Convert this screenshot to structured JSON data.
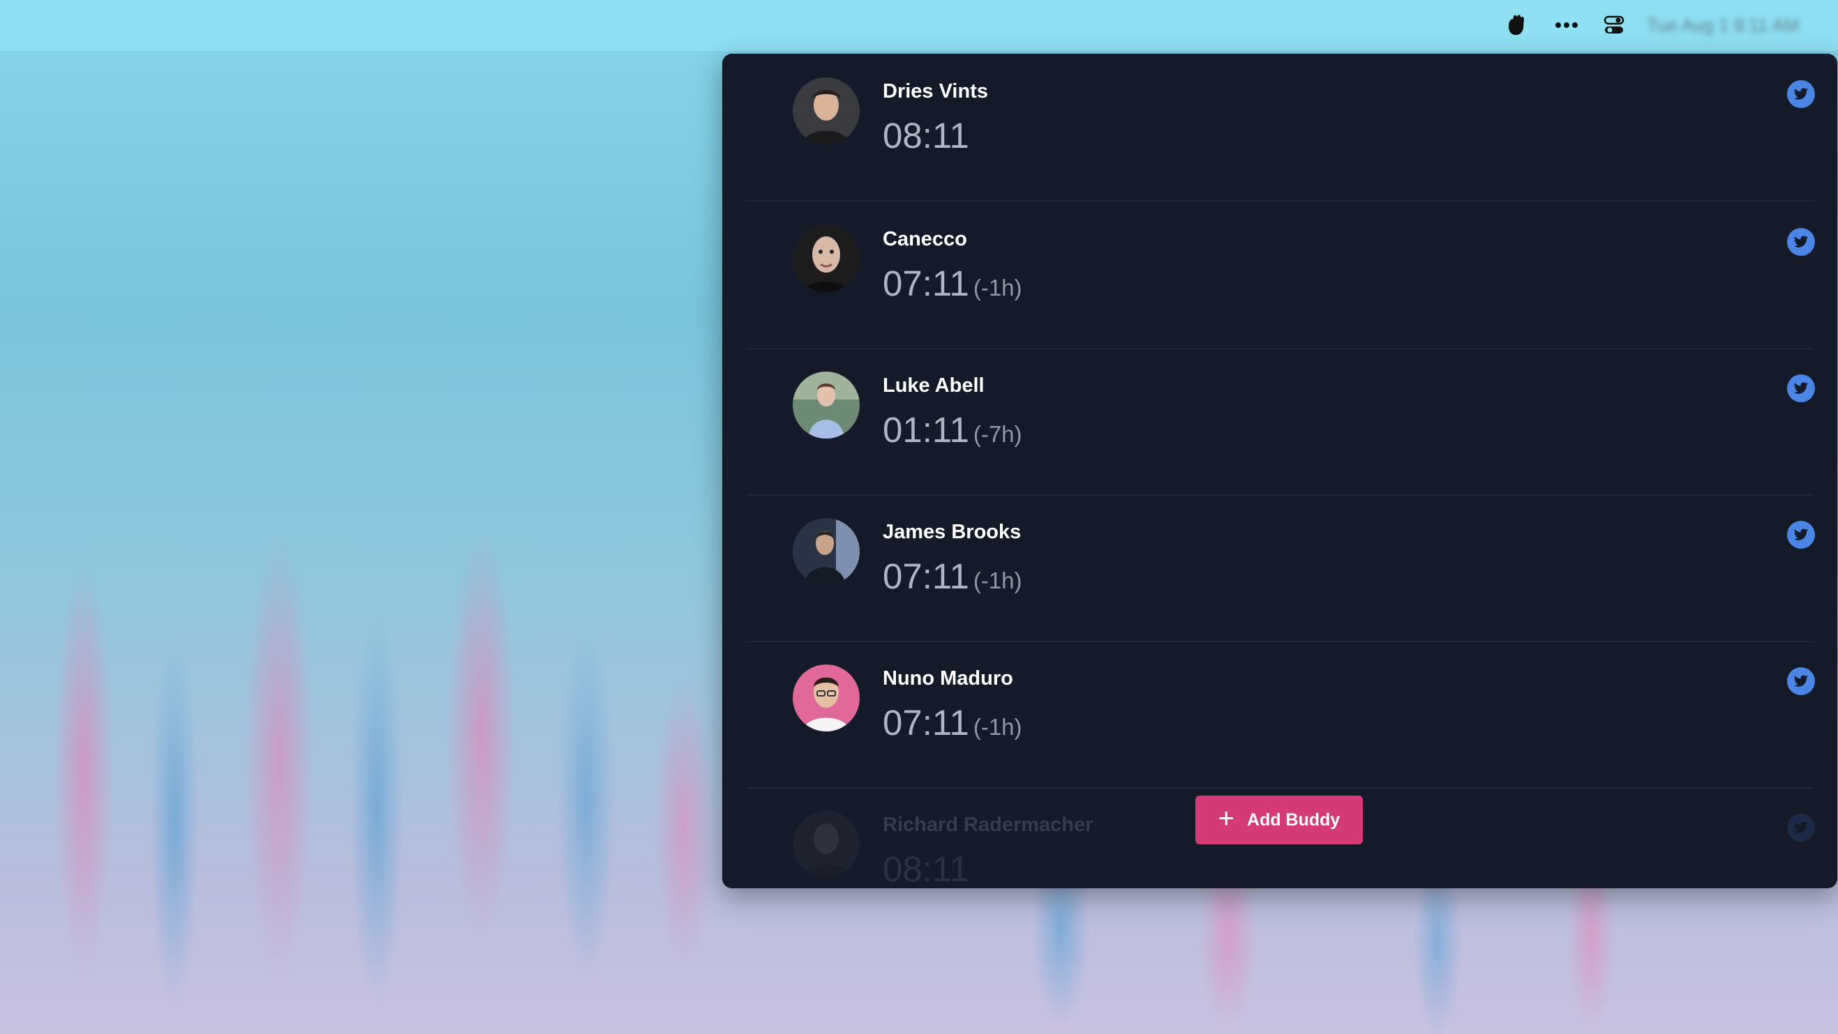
{
  "menubar": {
    "icons": [
      "hand-wave-icon",
      "more-icon",
      "control-center-icon"
    ],
    "clock": "Tue Aug 1 8:11 AM"
  },
  "buddies": [
    {
      "name": "Dries Vints",
      "time": "08:11",
      "offset": "",
      "avatar_bg": "#3a3b3f",
      "twitter_icon": "twitter-icon"
    },
    {
      "name": "Canecco",
      "time": "07:11",
      "offset": "(-1h)",
      "avatar_bg": "#1c1c1c",
      "twitter_icon": "twitter-icon"
    },
    {
      "name": "Luke Abell",
      "time": "01:11",
      "offset": "(-7h)",
      "avatar_bg": "#6f8a74",
      "twitter_icon": "twitter-icon"
    },
    {
      "name": "James Brooks",
      "time": "07:11",
      "offset": "(-1h)",
      "avatar_bg": "#2a3444",
      "twitter_icon": "twitter-icon"
    },
    {
      "name": "Nuno Maduro",
      "time": "07:11",
      "offset": "(-1h)",
      "avatar_bg": "#e0699a",
      "twitter_icon": "twitter-icon"
    },
    {
      "name": "Richard Radermacher",
      "time": "08:11",
      "offset": "",
      "avatar_bg": "#555555",
      "twitter_icon": "twitter-icon"
    }
  ],
  "add_button": {
    "label": "Add Buddy",
    "icon": "plus-icon"
  },
  "colors": {
    "panel_bg": "#141a28",
    "accent_button": "#d43b76",
    "twitter_badge": "#4b86e6",
    "menubar_bg": "#8ee0f2"
  }
}
